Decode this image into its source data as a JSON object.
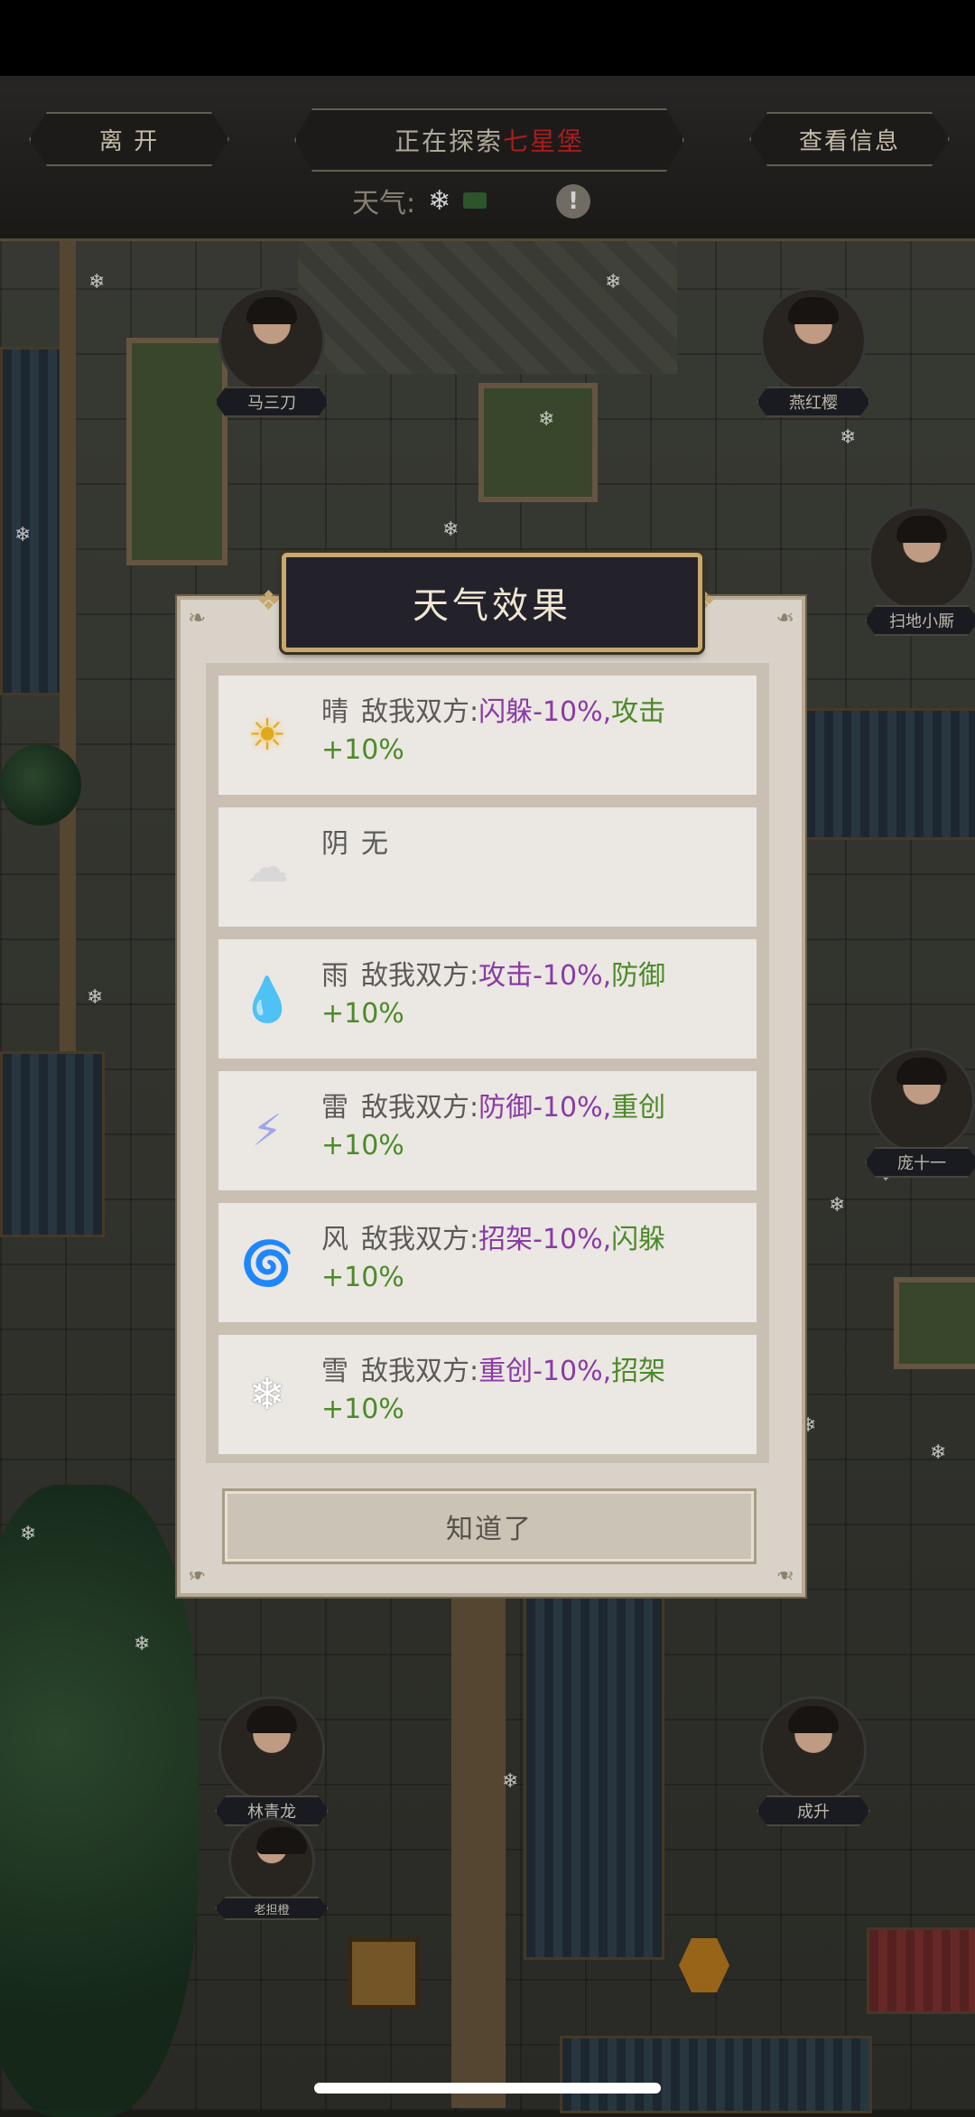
{
  "topbar": {
    "leave_label": "离 开",
    "exploring_prefix": "正在探索",
    "exploring_place": "七星堡",
    "view_info_label": "查看信息",
    "weather_label": "天气:",
    "weather_icon": "snowflake-icon",
    "info_glyph": "!"
  },
  "characters": {
    "ma_sandao": "马三刀",
    "yan_hongying": "燕红樱",
    "saodi_xiaosi": "扫地小厮",
    "pang_shiyi": "庞十一",
    "lin_qinglong": "林青龙",
    "lao_zubu": "老担橙",
    "cheng_sheng": "成升"
  },
  "modal": {
    "title": "天气效果",
    "ok_label": "知道了",
    "effects": [
      {
        "icon": "sun-icon",
        "glyph": "☀",
        "color": "#e0a91c",
        "name": "晴",
        "prefix": "敌我双方:",
        "neg": "闪躲-10%,",
        "pos": "攻击+10%"
      },
      {
        "icon": "cloud-icon",
        "glyph": "☁",
        "color": "#d8d8d8",
        "name": "阴",
        "prefix": "无",
        "neg": "",
        "pos": ""
      },
      {
        "icon": "rain-icon",
        "glyph": "💧",
        "color": "#5a9ad6",
        "name": "雨",
        "prefix": "敌我双方:",
        "neg": "攻击-10%,",
        "pos": "防御+10%"
      },
      {
        "icon": "thunder-icon",
        "glyph": "⚡",
        "color": "#9fa6e8",
        "name": "雷",
        "prefix": "敌我双方:",
        "neg": "防御-10%,",
        "pos": "重创+10%"
      },
      {
        "icon": "wind-icon",
        "glyph": "🌀",
        "color": "#bdbdbd",
        "name": "风",
        "prefix": "敌我双方:",
        "neg": "招架-10%,",
        "pos": "闪躲+10%"
      },
      {
        "icon": "snow-icon",
        "glyph": "❄",
        "color": "#ffffff",
        "name": "雪",
        "prefix": "敌我双方:",
        "neg": "重创-10%,",
        "pos": "招架+10%"
      }
    ]
  }
}
